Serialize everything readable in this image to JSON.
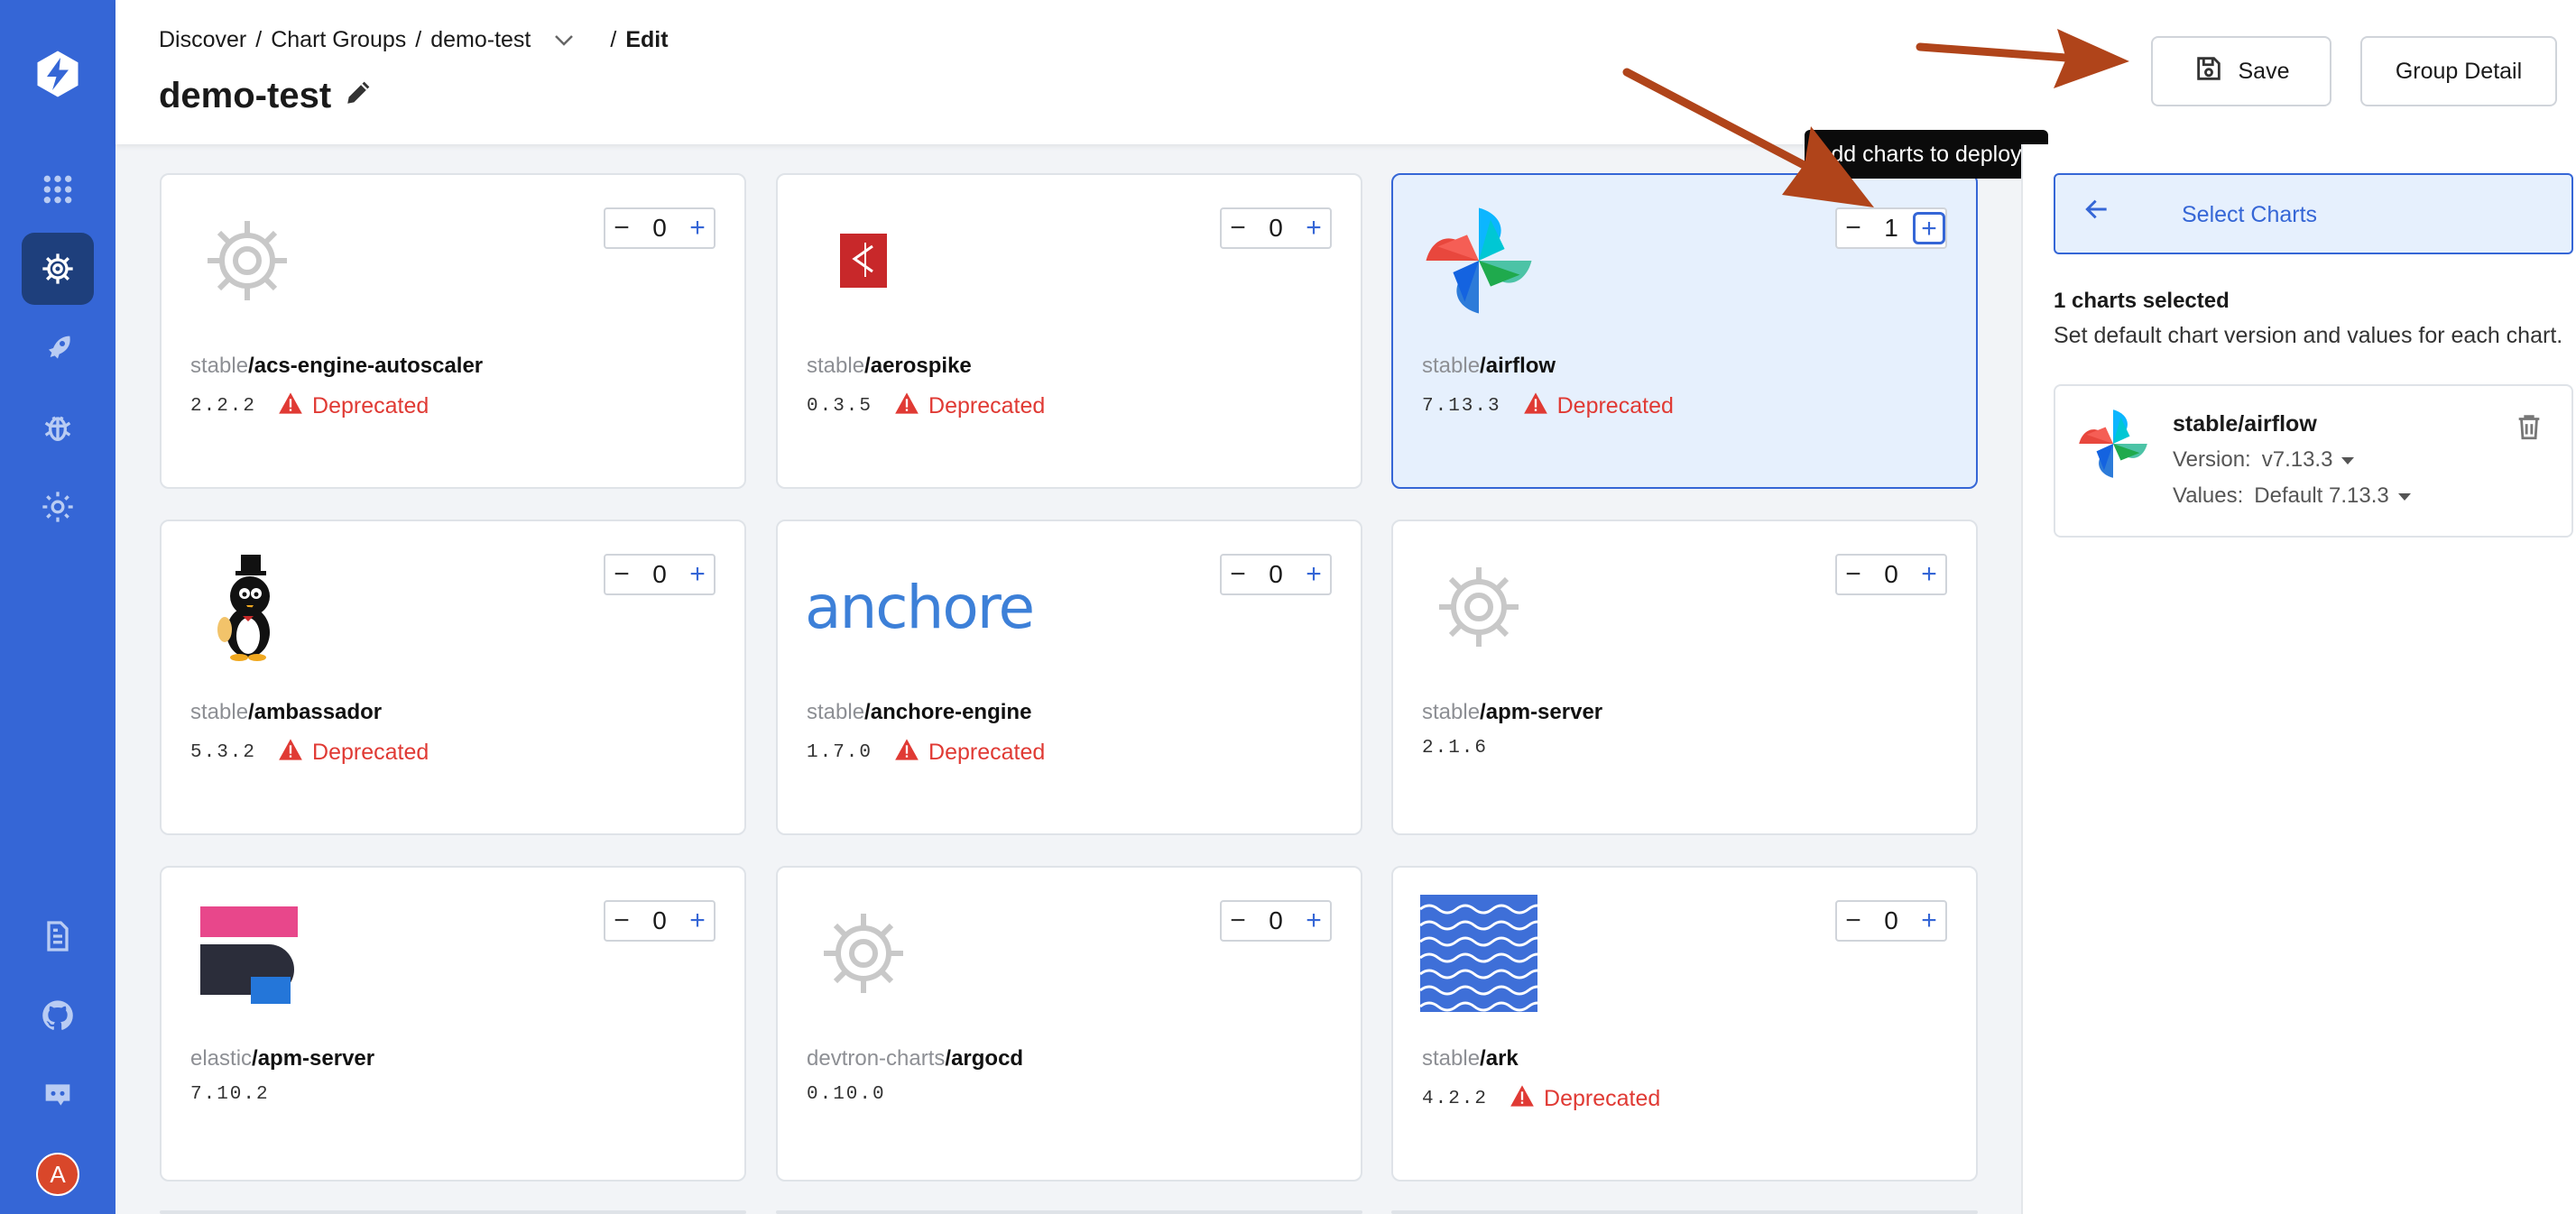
{
  "breadcrumb": {
    "discover": "Discover",
    "sep1": "/",
    "chart_groups": "Chart Groups",
    "sep2": "/",
    "group": "demo-test",
    "sep3": "/",
    "edit": "Edit"
  },
  "page": {
    "title": "demo-test"
  },
  "toolbar": {
    "save_label": "Save",
    "group_detail_label": "Group Detail"
  },
  "tooltip": {
    "text": "dd charts to deploy"
  },
  "charts": [
    {
      "repo": "stable",
      "name": "/acs-engine-autoscaler",
      "version": "2.2.2",
      "count": "0",
      "deprecated": "Deprecated",
      "icon": "helm-wheel-icon"
    },
    {
      "repo": "stable",
      "name": "/aerospike",
      "version": "0.3.5",
      "count": "0",
      "deprecated": "Deprecated",
      "icon": "aerospike-logo"
    },
    {
      "repo": "stable",
      "name": "/airflow",
      "version": "7.13.3",
      "count": "1",
      "deprecated": "Deprecated",
      "icon": "airflow-pinwheel-logo",
      "selected": true
    },
    {
      "repo": "stable",
      "name": "/ambassador",
      "version": "5.3.2",
      "count": "0",
      "deprecated": "Deprecated",
      "icon": "ambassador-mascot-logo"
    },
    {
      "repo": "stable",
      "name": "/anchore-engine",
      "version": "1.7.0",
      "count": "0",
      "deprecated": "Deprecated",
      "icon": "anchore-logo",
      "logo_text": "anchore"
    },
    {
      "repo": "stable",
      "name": "/apm-server",
      "version": "2.1.6",
      "count": "0",
      "deprecated": "",
      "icon": "helm-wheel-icon"
    },
    {
      "repo": "elastic",
      "name": "/apm-server",
      "version": "7.10.2",
      "count": "0",
      "deprecated": "",
      "icon": "elastic-apm-logo"
    },
    {
      "repo": "devtron-charts",
      "name": "/argocd",
      "version": "0.10.0",
      "count": "0",
      "deprecated": "",
      "icon": "helm-wheel-icon"
    },
    {
      "repo": "stable",
      "name": "/ark",
      "version": "4.2.2",
      "count": "0",
      "deprecated": "Deprecated",
      "icon": "ark-waves-logo"
    }
  ],
  "stepper": {
    "minus": "−",
    "plus": "+"
  },
  "right_panel": {
    "select_charts_label": "Select Charts",
    "selected_count": "1 charts selected",
    "selected_sub": "Set default chart version and values for each chart.",
    "selected_chart": {
      "name": "stable/airflow",
      "version_label": "Version:",
      "version_value": "v7.13.3",
      "values_label": "Values:",
      "values_value": "Default 7.13.3"
    }
  },
  "user": {
    "avatar_initial": "A"
  },
  "colors": {
    "primary": "#3566d6",
    "sidebar_active": "#1e3f7c",
    "deprecated": "#e03a34",
    "arrow": "#b0441a"
  }
}
